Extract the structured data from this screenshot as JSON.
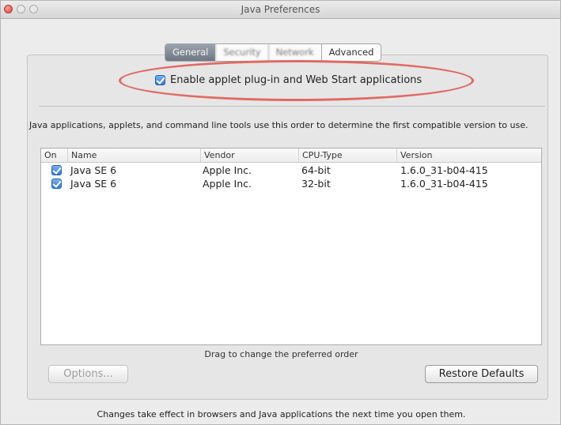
{
  "window": {
    "title": "Java Preferences"
  },
  "tabs": [
    {
      "label": "General",
      "selected": true
    },
    {
      "label": "Security",
      "selected": false
    },
    {
      "label": "Network",
      "selected": false
    },
    {
      "label": "Advanced",
      "selected": false
    }
  ],
  "general": {
    "enable_checkbox_label": "Enable applet plug-in and Web Start applications",
    "enable_checked": true,
    "description": "Java applications, applets, and command line tools use this order to determine the first compatible version to use."
  },
  "table": {
    "columns": [
      "On",
      "Name",
      "Vendor",
      "CPU-Type",
      "Version"
    ],
    "rows": [
      {
        "on": true,
        "name": "Java SE 6",
        "vendor": "Apple Inc.",
        "cpu": "64-bit",
        "version": "1.6.0_31-b04-415"
      },
      {
        "on": true,
        "name": "Java SE 6",
        "vendor": "Apple Inc.",
        "cpu": "32-bit",
        "version": "1.6.0_31-b04-415"
      }
    ]
  },
  "drag_hint": "Drag to change the preferred order",
  "buttons": {
    "options": "Options...",
    "restore": "Restore Defaults"
  },
  "footer": "Changes take effect in browsers and Java applications the next time you open them.",
  "colors": {
    "highlight": "#e06a64",
    "checkbox": "#2f7ad8",
    "selected_tab": "#7f8892"
  },
  "icons": {
    "checkbox": "checkmark-icon"
  }
}
